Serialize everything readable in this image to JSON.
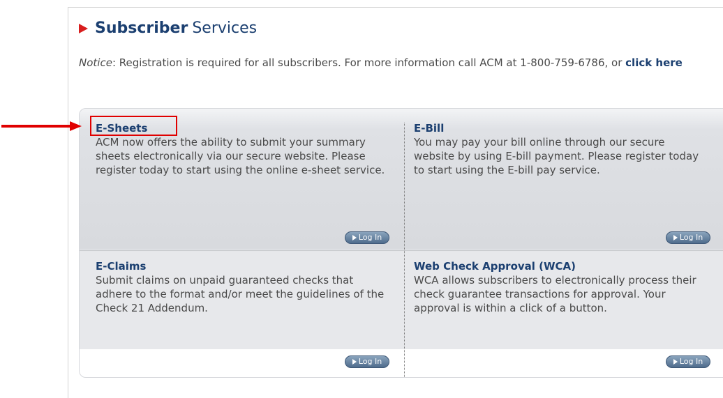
{
  "header": {
    "title_strong": "Subscriber",
    "title_rest": "Services"
  },
  "notice": {
    "label": "Notice",
    "text": ": Registration is required for all subscribers. For more information call ACM at 1-800-759-6786, or ",
    "link": "click here"
  },
  "services": {
    "esheets": {
      "title": "E-Sheets",
      "description": "ACM now offers the ability to submit your summary sheets electronically via our secure website. Please register today to start using the online e-sheet service.",
      "button": "Log In"
    },
    "ebill": {
      "title": "E-Bill",
      "description": "You may pay your bill online through our secure website by using E-bill payment. Please register today to start using the E-bill pay service.",
      "button": "Log In"
    },
    "eclaims": {
      "title": "E-Claims",
      "description": "Submit claims on unpaid guaranteed checks that adhere to the format and/or meet the guidelines of the Check 21 Addendum.",
      "button": "Log In"
    },
    "wca": {
      "title": "Web Check Approval (WCA)",
      "description": "WCA allows subscribers to electronically process their check guarantee transactions for approval. Your approval is within a click of a button.",
      "button": "Log In"
    }
  },
  "colors": {
    "accent_red": "#e00000",
    "heading_blue": "#1b3f70",
    "button_blue": "#4f6c8c"
  }
}
